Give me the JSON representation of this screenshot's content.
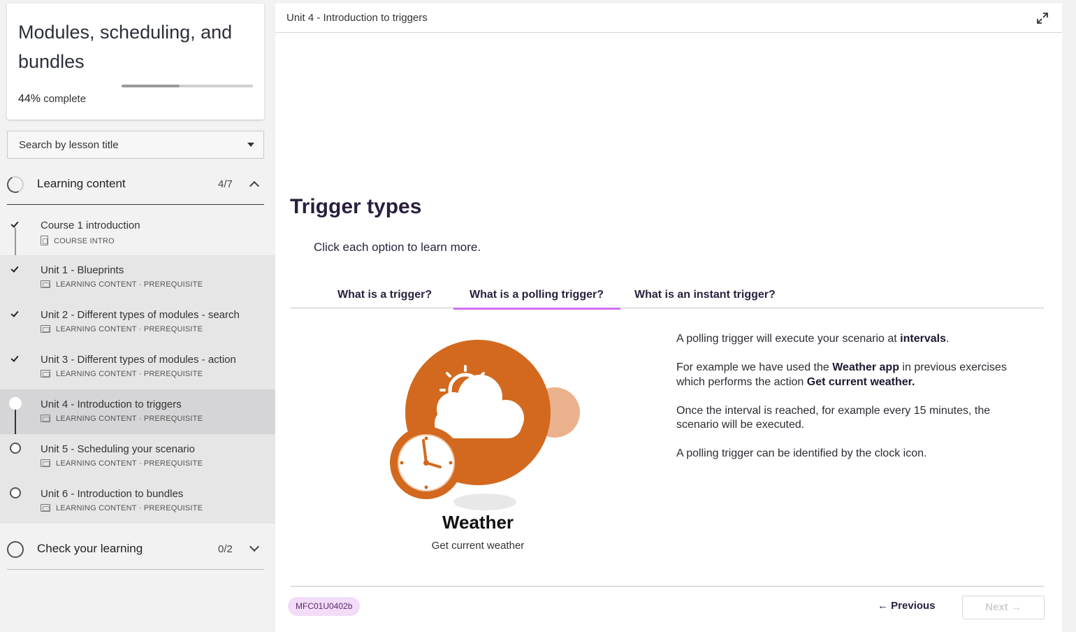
{
  "course": {
    "title": "Modules, scheduling, and bundles",
    "progress_value": 44,
    "progress_pct": "44%",
    "progress_suffix": " complete"
  },
  "search": {
    "label": "Search by lesson title"
  },
  "sections": [
    {
      "title": "Learning content",
      "count": "4/7"
    },
    {
      "title": "Check your learning",
      "count": "0/2"
    }
  ],
  "lessons": [
    {
      "title": "Course 1 introduction",
      "meta": "COURSE INTRO",
      "status": "complete"
    },
    {
      "title": "Unit 1 - Blueprints",
      "meta": "LEARNING CONTENT · PREREQUISITE",
      "status": "complete"
    },
    {
      "title": "Unit 2 - Different types of modules - search",
      "meta": "LEARNING CONTENT · PREREQUISITE",
      "status": "complete"
    },
    {
      "title": "Unit 3 - Different types of modules - action",
      "meta": "LEARNING CONTENT · PREREQUISITE",
      "status": "complete"
    },
    {
      "title": "Unit 4 - Introduction to triggers",
      "meta": "LEARNING CONTENT · PREREQUISITE",
      "status": "current"
    },
    {
      "title": "Unit 5 - Scheduling your scenario",
      "meta": "LEARNING CONTENT · PREREQUISITE",
      "status": "not-started"
    },
    {
      "title": "Unit 6 - Introduction to bundles",
      "meta": "LEARNING CONTENT · PREREQUISITE",
      "status": "not-started"
    }
  ],
  "main": {
    "topbar_title": "Unit 4 - Introduction to triggers",
    "heading": "Trigger types",
    "instruction": "Click each option to learn more.",
    "tabs": [
      {
        "label": "What is a trigger?"
      },
      {
        "label": "What is a polling trigger?"
      },
      {
        "label": "What is an instant trigger?"
      }
    ],
    "active_tab": 1,
    "app_card": {
      "name": "Weather",
      "action": "Get current weather"
    },
    "info": {
      "p1_a": "A polling trigger will execute your scenario at ",
      "p1_b": "intervals",
      "p1_c": ".",
      "p2_a": "For example we have used the ",
      "p2_b": "Weather app",
      "p2_c": " in previous exercises which performs the action ",
      "p2_d": "Get current weather.",
      "p3": "Once the interval is reached, for example every 15 minutes, the scenario will be executed.",
      "p4": "A polling trigger can be identified by the clock icon."
    },
    "footer": {
      "code": "MFC01U0402b",
      "prev_label": "← Previous",
      "next_label": "Next →"
    }
  },
  "colors": {
    "accent_underline": "#d06ff0",
    "badge_bg": "#f2dcf8",
    "weather_orange": "#d2691e",
    "heading": "#2a1f3d"
  },
  "icons": [
    "check-icon",
    "caret-down-icon",
    "chevron-up-icon",
    "chevron-down-icon",
    "expand-icon",
    "clock-icon",
    "weather-icon"
  ]
}
